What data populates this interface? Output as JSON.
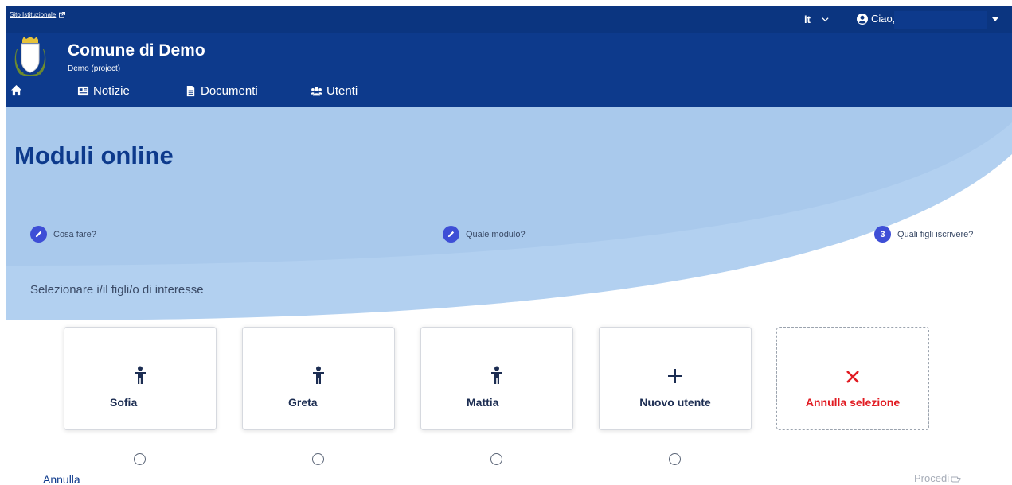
{
  "topbar": {
    "institutional_link": "Sito Istituzionale",
    "language": "it",
    "greeting": "Ciao,"
  },
  "header": {
    "title": "Comune di Demo",
    "subtitle": "Demo (project)",
    "nav": [
      {
        "label": "Notizie",
        "icon": "newspaper-icon"
      },
      {
        "label": "Documenti",
        "icon": "file-icon"
      },
      {
        "label": "Utenti",
        "icon": "users-icon"
      }
    ]
  },
  "main": {
    "page_title": "Moduli online",
    "steps": [
      {
        "label": "Cosa fare?",
        "state": "done"
      },
      {
        "label": "Quale modulo?",
        "state": "done"
      },
      {
        "label": "Quali figli iscrivere?",
        "state": "current",
        "number": "3"
      }
    ],
    "prompt": "Selezionare i/il figli/o di interesse",
    "cards": [
      {
        "label": "Sofia",
        "icon": "child-icon"
      },
      {
        "label": "Greta",
        "icon": "child-icon"
      },
      {
        "label": "Mattia",
        "icon": "child-icon"
      },
      {
        "label": "Nuovo utente",
        "icon": "plus-icon"
      },
      {
        "label": "Annulla selezione",
        "icon": "x-icon"
      }
    ],
    "cancel_label": "Annulla",
    "proceed_label": "Procedi"
  },
  "colors": {
    "brand": "#0d3a8c",
    "topbar": "#0b3580",
    "step_badge": "#3e4ed6",
    "danger": "#e11b22",
    "hero_light": "#d6e6f8"
  }
}
